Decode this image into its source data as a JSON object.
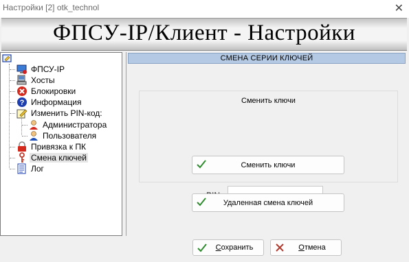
{
  "window": {
    "title": "Настройки [2] otk_technol",
    "close": "✕"
  },
  "banner": {
    "heading": "ФПСУ-IP/Клиент - Настройки"
  },
  "tree": {
    "items": [
      {
        "label": "ФПСУ-IP",
        "icon": "computer-monitor-icon"
      },
      {
        "label": "Хосты",
        "icon": "computer-hosts-icon"
      },
      {
        "label": "Блокировки",
        "icon": "block-red-x-icon"
      },
      {
        "label": "Информация",
        "icon": "info-question-icon"
      },
      {
        "label": "Изменить PIN-код:",
        "icon": "edit-pencil-icon"
      },
      {
        "label": "Администратора",
        "icon": "admin-user-icon"
      },
      {
        "label": "Пользователя",
        "icon": "user-icon"
      },
      {
        "label": "Привязка к ПК",
        "icon": "padlock-icon"
      },
      {
        "label": "Смена ключей",
        "icon": "key-icon"
      },
      {
        "label": "Лог",
        "icon": "log-document-icon"
      }
    ],
    "selected": "Смена ключей"
  },
  "panel": {
    "header": "СМЕНА СЕРИИ КЛЮЧЕЙ",
    "group_caption": "Сменить ключи",
    "pin_label": "PIN",
    "pin_value": "",
    "change_button": "Сменить ключи",
    "remote_button": "Удаленная смена ключей"
  },
  "footer": {
    "save": "Сохранить",
    "save_accesskey": "С",
    "save_rest": "охранить",
    "cancel": "Отмена",
    "cancel_accesskey": "О",
    "cancel_rest": "тмена"
  },
  "colors": {
    "header_bg": "#b4c9e3",
    "check_green": "#2e8b2e",
    "cancel_red": "#b03a2e"
  }
}
